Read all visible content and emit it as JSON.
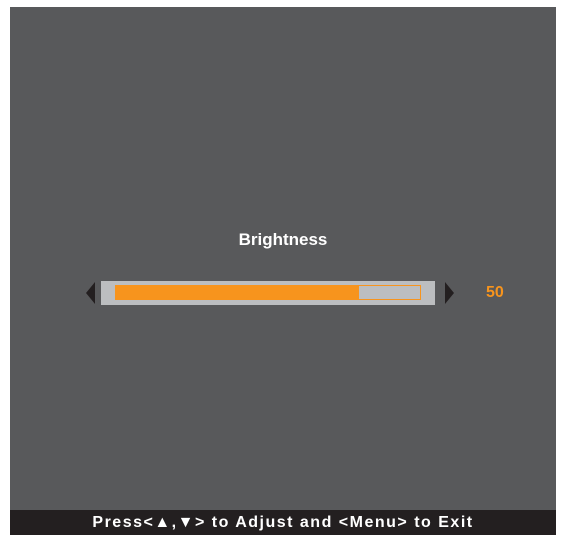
{
  "osd": {
    "title": "Brightness",
    "value": "50",
    "level_fraction": 0.8,
    "hint": "Press<▲,▼> to Adjust and <Menu> to Exit"
  },
  "icons": {
    "decrease": "left-arrow-icon",
    "increase": "right-arrow-icon"
  },
  "colors": {
    "background": "#58595b",
    "accent": "#f7941d",
    "track": "#bcbec0",
    "hint_bar": "#231f20",
    "text": "#ffffff"
  }
}
